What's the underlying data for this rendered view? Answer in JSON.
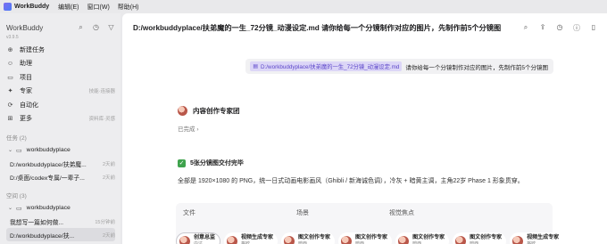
{
  "menubar": {
    "app_name": "WorkBuddy",
    "menus": [
      "编辑(E)",
      "窗口(W)",
      "帮助(H)"
    ]
  },
  "sidebar": {
    "brand": "WorkBuddy",
    "version": "v3.9.5",
    "tool_icons": [
      "search-icon",
      "clock-icon",
      "filter-icon"
    ],
    "nav": [
      {
        "label": "新建任务",
        "icon": "plus-circle-icon",
        "aside": ""
      },
      {
        "label": "助理",
        "icon": "assistant-icon",
        "aside": ""
      },
      {
        "label": "项目",
        "icon": "folder-icon",
        "aside": ""
      },
      {
        "label": "专家",
        "icon": "expert-icon",
        "aside": "技能·连接器"
      },
      {
        "label": "自动化",
        "icon": "automation-icon",
        "aside": ""
      },
      {
        "label": "更多",
        "icon": "grid-icon",
        "aside": "资料库·灵感"
      }
    ],
    "tasks_heading": "任务 (2)",
    "tasks": [
      {
        "label": "workbuddyplace",
        "time": "",
        "kind": "folder"
      },
      {
        "label": "D:/workbuddyplace/扶弟魔...",
        "time": "2天前"
      },
      {
        "label": "D:/桌面/codex专属/一辈子...",
        "time": "2天前"
      }
    ],
    "space_heading": "空间 (3)",
    "space": [
      {
        "label": "workbuddyplace",
        "kind": "folder"
      },
      {
        "label": "我想写一篇如何做...",
        "time": "15分钟前"
      },
      {
        "label": "D:/workbuddyplace/扶...",
        "time": "2天前",
        "active": true
      }
    ]
  },
  "main": {
    "title": "D:/workbuddyplace/扶弟魔的一生_72分镜_动漫设定.md 请你给每一个分镜制作对应的图片，先制作前5个分镜图",
    "header_icons": [
      "search-icon",
      "share-icon",
      "history-icon",
      "info-icon",
      "panel-icon"
    ],
    "user_message": {
      "file": "D:/workbuddyplace/扶弟魔的一生_72分镜_动漫设定.md",
      "text": "请你给每一个分镜制作对应的图片，先制作前5个分镜图"
    },
    "agent": {
      "name": "内容创作专家团",
      "status": "已完成",
      "status_chevron": "›"
    },
    "result": {
      "done_title": "5张分镜图交付完毕",
      "summary": "全部是 1920×1080 的 PNG，统一日式动画电影画风（Ghibli / 新海诚色调），冷灰 + 暗黄主调，主角22岁 Phase 1 形象贯穿。"
    },
    "table": {
      "headers": [
        "文件",
        "场景",
        "视觉焦点"
      ]
    },
    "agent_chips": [
      {
        "name": "创意总监",
        "sub": "内达"
      },
      {
        "name": "视频生成专家",
        "sub": "格欧"
      },
      {
        "name": "图文创作专家",
        "sub": "暗西"
      },
      {
        "name": "图文创作专家",
        "sub": "暗西"
      },
      {
        "name": "图文创作专家",
        "sub": "暗西"
      },
      {
        "name": "图文创作专家",
        "sub": "暗西"
      },
      {
        "name": "视频生成专家",
        "sub": "格欧"
      }
    ]
  },
  "colors": {
    "accent_purple": "#5b46c9",
    "chip_bg": "#dcd6f7",
    "success_green": "#3fa34d",
    "sidebar_bg": "#ededef"
  }
}
